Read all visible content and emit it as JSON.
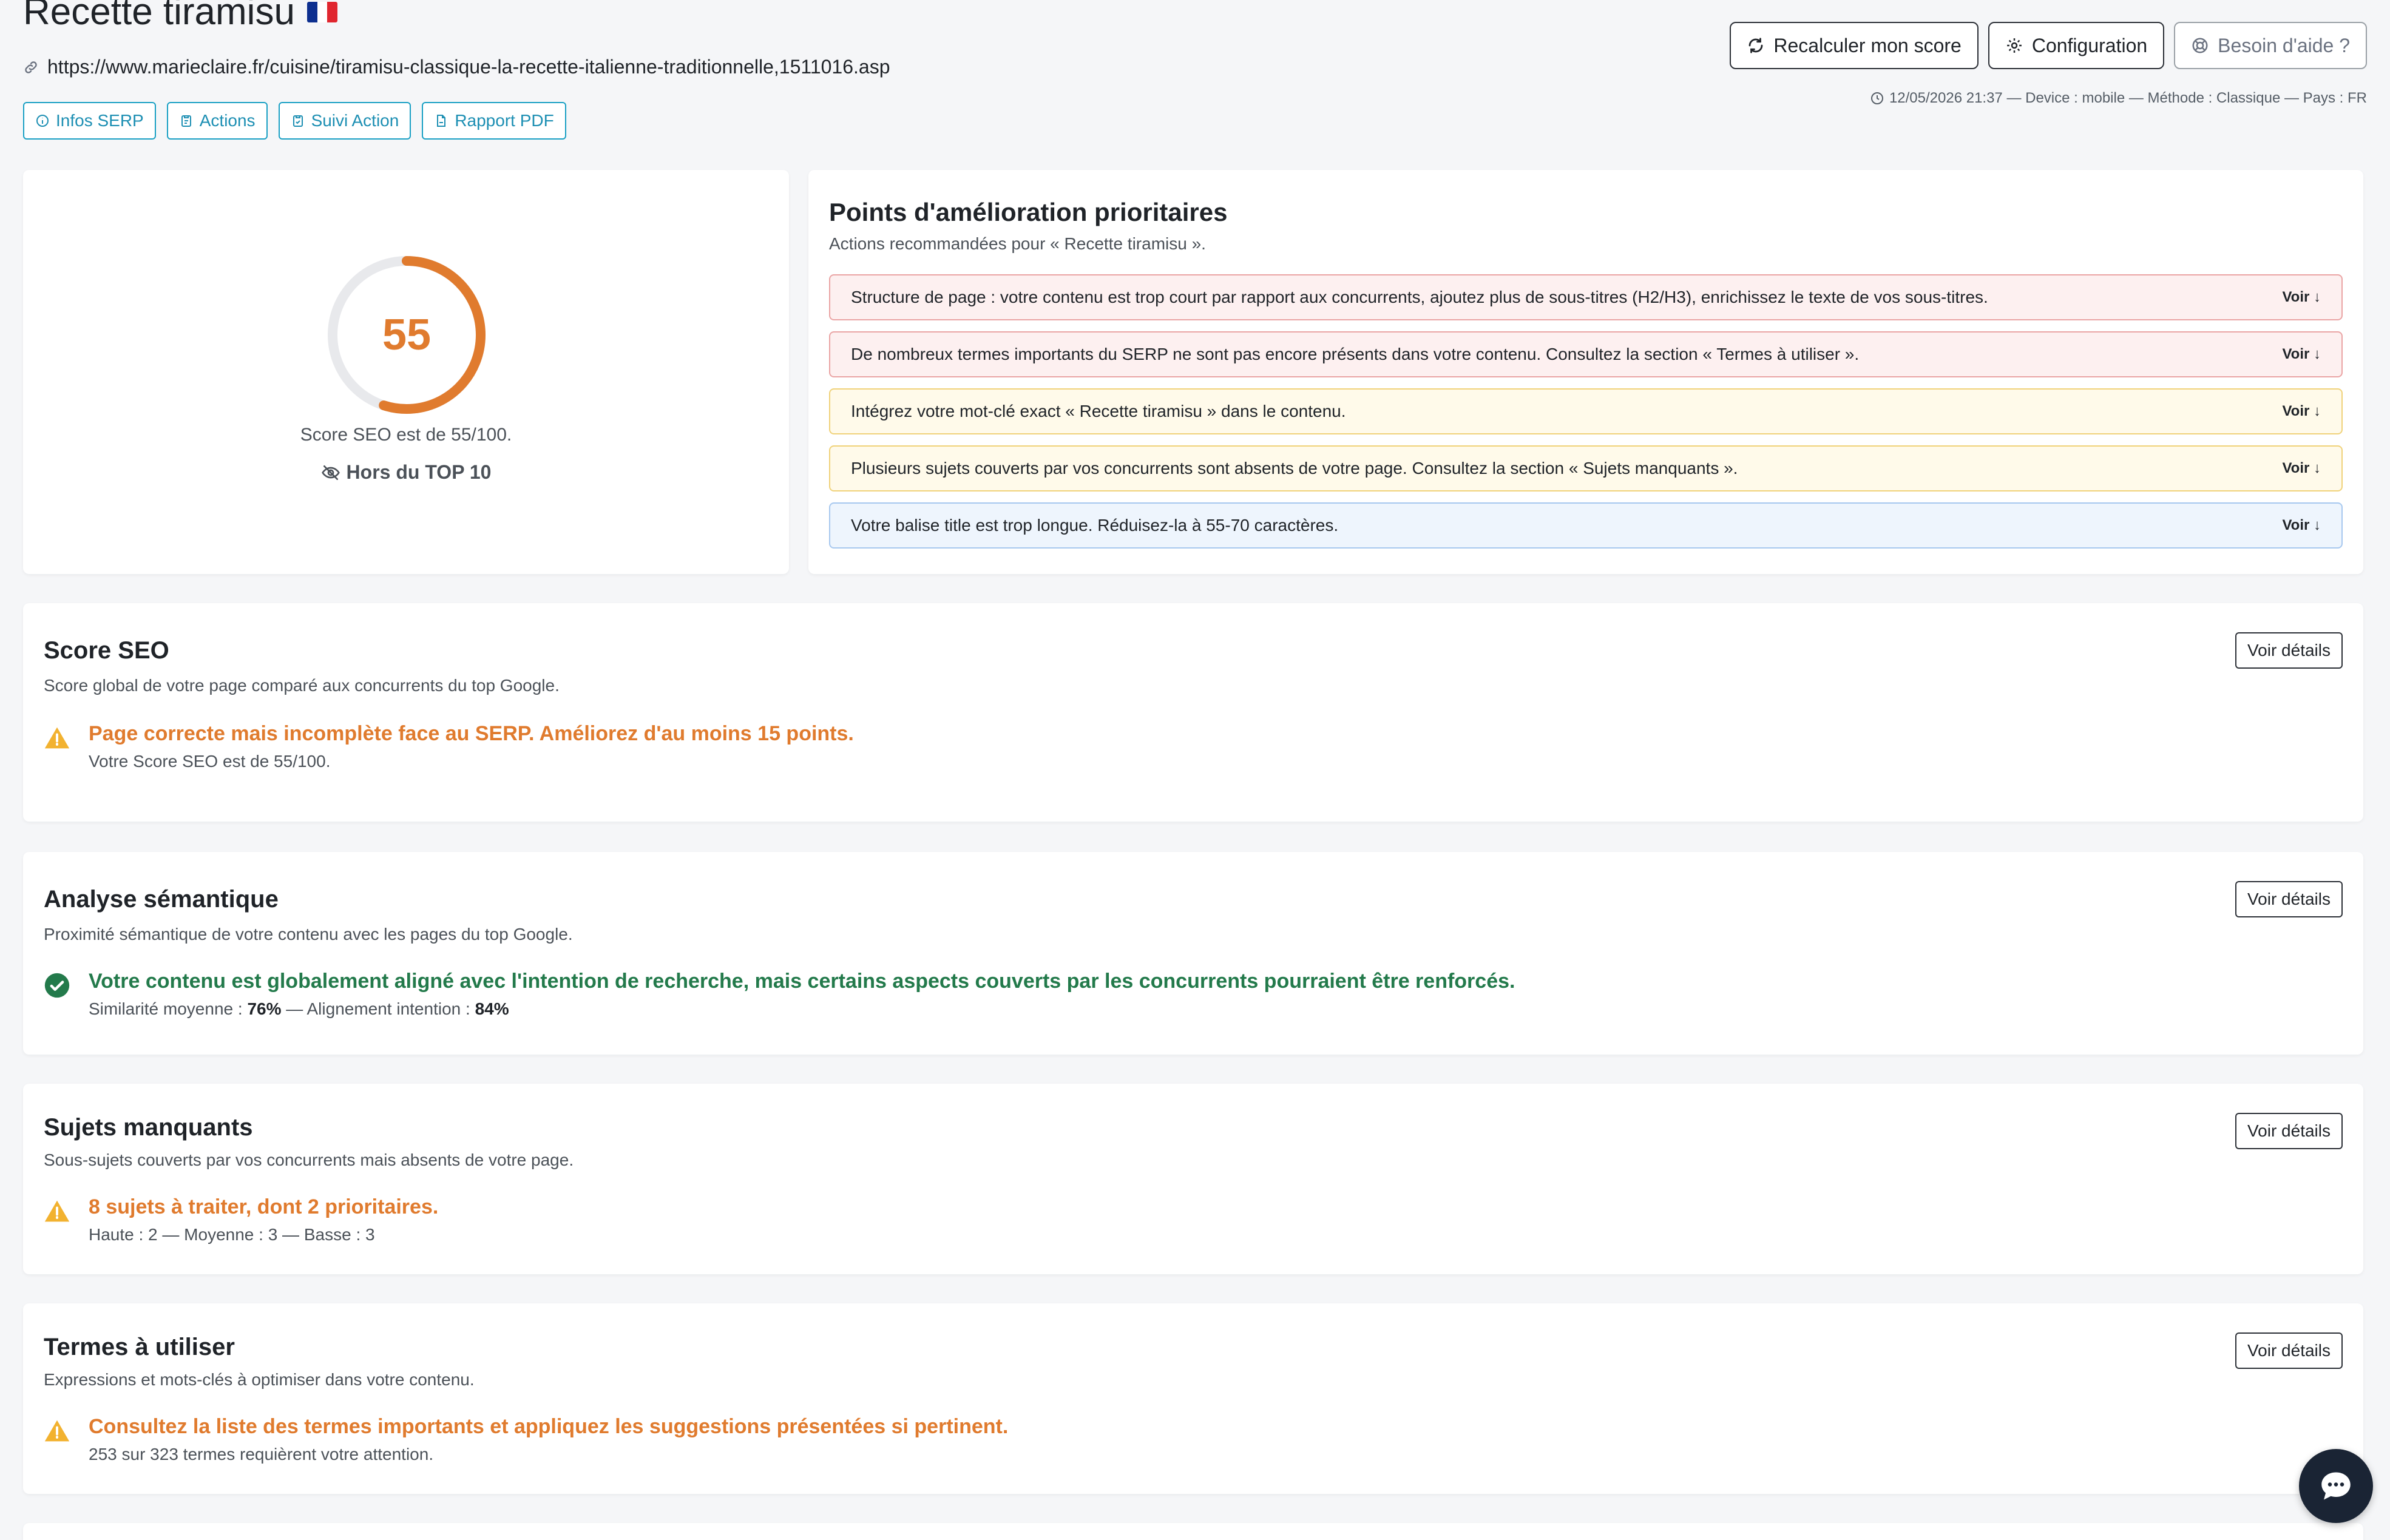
{
  "header": {
    "title": "Recette tiramisu",
    "url": "https://www.marieclaire.fr/cuisine/tiramisu-classique-la-recette-italienne-traditionnelle,1511016.asp",
    "tabs": [
      "Infos SERP",
      "Actions",
      "Suivi Action",
      "Rapport PDF"
    ],
    "buttons": {
      "recalc": "Recalculer mon score",
      "config": "Configuration",
      "help": "Besoin d'aide ?"
    },
    "meta": "12/05/2026 21:37 — Device : mobile — Méthode : Classique — Pays : FR"
  },
  "score_card": {
    "value": "55",
    "fraction": 0.55,
    "text": "Score SEO est de 55/100.",
    "rank": "Hors du TOP 10"
  },
  "improvements": {
    "title": "Points d'amélioration prioritaires",
    "subtitle": "Actions recommandées pour « Recette tiramisu ».",
    "voir_label": "Voir ↓",
    "items": [
      {
        "text": "Structure de page : votre contenu est trop court par rapport aux concurrents, ajoutez plus de sous-titres (H2/H3), enrichissez le texte de vos sous-titres.",
        "level": "red"
      },
      {
        "text": "De nombreux termes importants du SERP ne sont pas encore présents dans votre contenu. Consultez la section « Termes à utiliser ».",
        "level": "red"
      },
      {
        "text": "Intégrez votre mot-clé exact « Recette tiramisu » dans le contenu.",
        "level": "yellow"
      },
      {
        "text": "Plusieurs sujets couverts par vos concurrents sont absents de votre page. Consultez la section « Sujets manquants ».",
        "level": "yellow"
      },
      {
        "text": "Votre balise title est trop longue. Réduisez-la à 55-70 caractères.",
        "level": "blue"
      }
    ]
  },
  "sections": {
    "details_label": "Voir détails",
    "seo": {
      "title": "Score SEO",
      "subtitle": "Score global de votre page comparé aux concurrents du top Google.",
      "message": "Page correcte mais incomplète face au SERP. Améliorez d'au moins 15 points.",
      "detail": "Votre Score SEO est de 55/100."
    },
    "semantic": {
      "title": "Analyse sémantique",
      "subtitle": "Proximité sémantique de votre contenu avec les pages du top Google.",
      "message": "Votre contenu est globalement aligné avec l'intention de recherche, mais certains aspects couverts par les concurrents pourraient être renforcés.",
      "similarity_label": "Similarité moyenne : ",
      "similarity": "76%",
      "sep": " — Alignement intention : ",
      "alignment": "84%"
    },
    "topics": {
      "title": "Sujets manquants",
      "subtitle": "Sous-sujets couverts par vos concurrents mais absents de votre page.",
      "message": "8 sujets à traiter, dont 2 prioritaires.",
      "detail": "Haute : 2 — Moyenne : 3 — Basse : 3"
    },
    "terms": {
      "title": "Termes à utiliser",
      "subtitle": "Expressions et mots-clés à optimiser dans votre contenu.",
      "message": "Consultez la liste des termes importants et appliquez les suggestions présentées si pertinent.",
      "detail": "253 sur 323 termes requièrent votre attention."
    }
  },
  "colors": {
    "accent": "#1aa0c4",
    "score": "#e07b2e",
    "success": "#237a4b",
    "warning": "#f2b230"
  }
}
